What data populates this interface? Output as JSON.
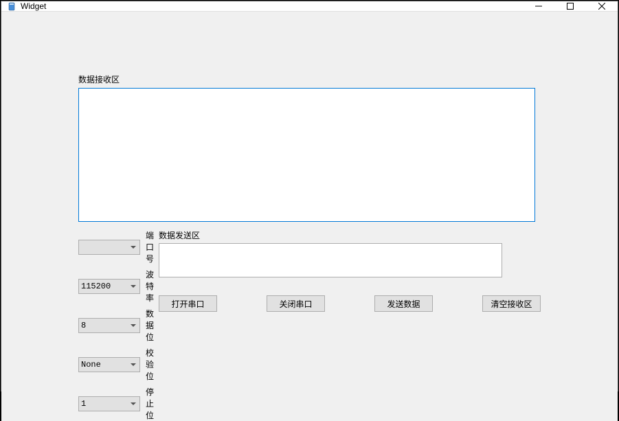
{
  "window": {
    "title": "Widget"
  },
  "labels": {
    "recv_area": "数据接收区",
    "send_area": "数据发送区",
    "port": "端口号",
    "baud": "波特率",
    "data_bits": "数据位",
    "parity": "校验位",
    "stop_bits": "停止位"
  },
  "settings": {
    "port_value": "",
    "baud_value": "115200",
    "data_bits_value": "8",
    "parity_value": "None",
    "stop_bits_value": "1"
  },
  "recv": {
    "content": ""
  },
  "send": {
    "content": ""
  },
  "buttons": {
    "open": "打开串口",
    "close": "关闭串口",
    "send": "发送数据",
    "clear": "清空接收区"
  }
}
